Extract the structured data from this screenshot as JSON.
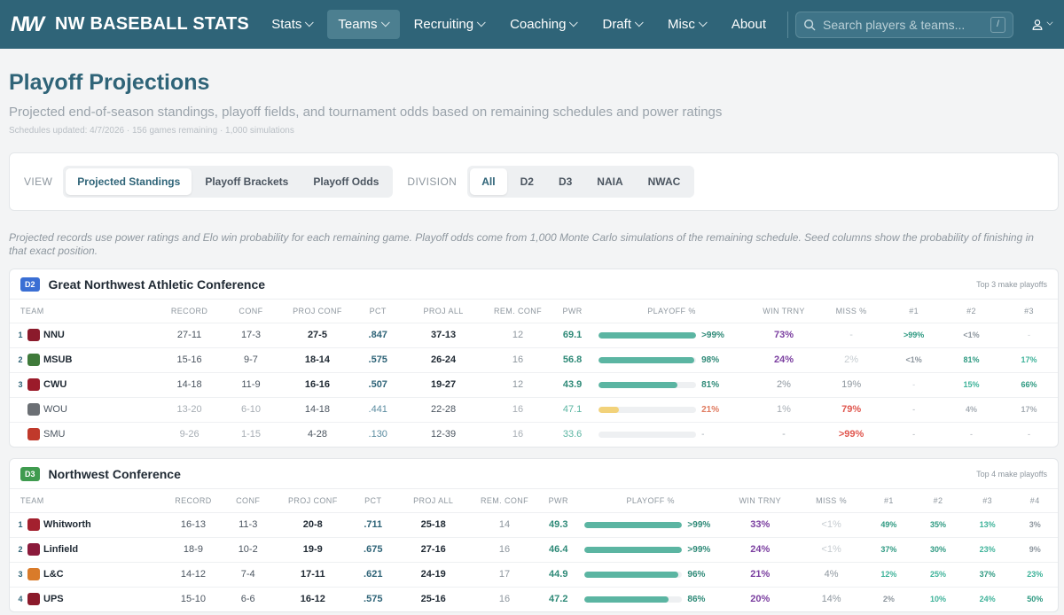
{
  "nav": {
    "logo": "NW",
    "brand": "NW BASEBALL STATS",
    "items": [
      {
        "label": "Stats",
        "dropdown": true,
        "active": false
      },
      {
        "label": "Teams",
        "dropdown": true,
        "active": true
      },
      {
        "label": "Recruiting",
        "dropdown": true,
        "active": false
      },
      {
        "label": "Coaching",
        "dropdown": true,
        "active": false
      },
      {
        "label": "Draft",
        "dropdown": true,
        "active": false
      },
      {
        "label": "Misc",
        "dropdown": true,
        "active": false
      },
      {
        "label": "About",
        "dropdown": false,
        "active": false
      }
    ],
    "search_placeholder": "Search players & teams...",
    "search_shortcut": "/"
  },
  "page": {
    "title": "Playoff Projections",
    "subtitle": "Projected end-of-season standings, playoff fields, and tournament odds based on remaining schedules and power ratings",
    "meta": "Schedules updated: 4/7/2026 · 156 games remaining · 1,000 simulations"
  },
  "filters": {
    "view_label": "VIEW",
    "view_options": [
      "Projected Standings",
      "Playoff Brackets",
      "Playoff Odds"
    ],
    "view_active": 0,
    "division_label": "DIVISION",
    "division_options": [
      "All",
      "D2",
      "D3",
      "NAIA",
      "NWAC"
    ],
    "division_active": 0
  },
  "note": "Projected records use power ratings and Elo win probability for each remaining game. Playoff odds come from 1,000 Monte Carlo simulations of the remaining schedule. Seed columns show the probability of finishing in that exact position.",
  "colors": {
    "accent": "#2f6478",
    "bar": "#5bb5a2",
    "win": "#7b3fa0",
    "miss_red": "#e0574f"
  },
  "conferences": [
    {
      "badge": "D2",
      "name": "Great Northwest Athletic Conference",
      "note": "Top 3 make playoffs",
      "headers": [
        "TEAM",
        "RECORD",
        "CONF",
        "PROJ CONF",
        "PCT",
        "PROJ ALL",
        "REM. CONF",
        "PWR",
        "PLAYOFF %",
        "WIN TRNY",
        "MISS %",
        "#1",
        "#2",
        "#3"
      ],
      "rows": [
        {
          "seed": "1",
          "team": "NNU",
          "logo_color": "#8b1a2b",
          "record": "27-11",
          "conf": "17-3",
          "proj_conf": "27-5",
          "pct": ".847",
          "proj_all": "37-13",
          "rem": "12",
          "pwr": "69.1",
          "playoff": ">99%",
          "playoff_frac": 1.0,
          "win": "73%",
          "miss": "-",
          "s": [
            ">99%",
            "<1%",
            "-"
          ],
          "dim": false
        },
        {
          "seed": "2",
          "team": "MSUB",
          "logo_color": "#3f7a3a",
          "record": "15-16",
          "conf": "9-7",
          "proj_conf": "18-14",
          "pct": ".575",
          "proj_all": "26-24",
          "rem": "16",
          "pwr": "56.8",
          "playoff": "98%",
          "playoff_frac": 0.98,
          "win": "24%",
          "miss": "2%",
          "s": [
            "<1%",
            "81%",
            "17%"
          ],
          "dim": false
        },
        {
          "seed": "3",
          "team": "CWU",
          "logo_color": "#9b1b2a",
          "record": "14-18",
          "conf": "11-9",
          "proj_conf": "16-16",
          "pct": ".507",
          "proj_all": "19-27",
          "rem": "12",
          "pwr": "43.9",
          "playoff": "81%",
          "playoff_frac": 0.81,
          "win": "2%",
          "miss": "19%",
          "s": [
            "-",
            "15%",
            "66%"
          ],
          "dim": false
        },
        {
          "seed": "",
          "team": "WOU",
          "logo_color": "#6b6f74",
          "record": "13-20",
          "conf": "6-10",
          "proj_conf": "14-18",
          "pct": ".441",
          "proj_all": "22-28",
          "rem": "16",
          "pwr": "47.1",
          "playoff": "21%",
          "playoff_frac": 0.21,
          "win": "1%",
          "miss": "79%",
          "s": [
            "-",
            "4%",
            "17%"
          ],
          "dim": true
        },
        {
          "seed": "",
          "team": "SMU",
          "logo_color": "#c0392b",
          "record": "9-26",
          "conf": "1-15",
          "proj_conf": "4-28",
          "pct": ".130",
          "proj_all": "12-39",
          "rem": "16",
          "pwr": "33.6",
          "playoff": "-",
          "playoff_frac": 0.0,
          "win": "-",
          "miss": ">99%",
          "s": [
            "-",
            "-",
            "-"
          ],
          "dim": true
        }
      ]
    },
    {
      "badge": "D3",
      "name": "Northwest Conference",
      "note": "Top 4 make playoffs",
      "headers": [
        "TEAM",
        "RECORD",
        "CONF",
        "PROJ CONF",
        "PCT",
        "PROJ ALL",
        "REM. CONF",
        "PWR",
        "PLAYOFF %",
        "WIN TRNY",
        "MISS %",
        "#1",
        "#2",
        "#3",
        "#4"
      ],
      "rows": [
        {
          "seed": "1",
          "team": "Whitworth",
          "logo_color": "#a3202e",
          "record": "16-13",
          "conf": "11-3",
          "proj_conf": "20-8",
          "pct": ".711",
          "proj_all": "25-18",
          "rem": "14",
          "pwr": "49.3",
          "playoff": ">99%",
          "playoff_frac": 1.0,
          "win": "33%",
          "miss": "<1%",
          "s": [
            "49%",
            "35%",
            "13%",
            "3%"
          ],
          "dim": false
        },
        {
          "seed": "2",
          "team": "Linfield",
          "logo_color": "#8b1a3b",
          "record": "18-9",
          "conf": "10-2",
          "proj_conf": "19-9",
          "pct": ".675",
          "proj_all": "27-16",
          "rem": "16",
          "pwr": "46.4",
          "playoff": ">99%",
          "playoff_frac": 1.0,
          "win": "24%",
          "miss": "<1%",
          "s": [
            "37%",
            "30%",
            "23%",
            "9%"
          ],
          "dim": false
        },
        {
          "seed": "3",
          "team": "L&C",
          "logo_color": "#d97b2a",
          "record": "14-12",
          "conf": "7-4",
          "proj_conf": "17-11",
          "pct": ".621",
          "proj_all": "24-19",
          "rem": "17",
          "pwr": "44.9",
          "playoff": "96%",
          "playoff_frac": 0.96,
          "win": "21%",
          "miss": "4%",
          "s": [
            "12%",
            "25%",
            "37%",
            "23%"
          ],
          "dim": false
        },
        {
          "seed": "4",
          "team": "UPS",
          "logo_color": "#8b1a2b",
          "record": "15-10",
          "conf": "6-6",
          "proj_conf": "16-12",
          "pct": ".575",
          "proj_all": "25-16",
          "rem": "16",
          "pwr": "47.2",
          "playoff": "86%",
          "playoff_frac": 0.86,
          "win": "20%",
          "miss": "14%",
          "s": [
            "2%",
            "10%",
            "24%",
            "50%"
          ],
          "dim": false
        }
      ]
    }
  ]
}
